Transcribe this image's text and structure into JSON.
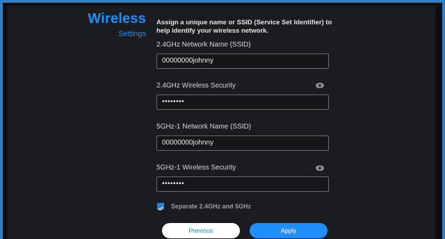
{
  "section": {
    "title": "Wireless",
    "subtitle": "Settings"
  },
  "intro_text": "Assign a unique name or SSID (Service Set Identifier) to help identify your wireless network.",
  "fields": {
    "ssid_24": {
      "label": "2.4GHz Network Name (SSID)",
      "value": "00000000johnny"
    },
    "security_24": {
      "label": "2.4GHz Wireless Security",
      "value": "••••••••"
    },
    "ssid_5": {
      "label": "5GHz-1 Network Name (SSID)",
      "value": "00000000johnny"
    },
    "security_5": {
      "label": "5GHz-1 Wireless Security",
      "value": "••••••••"
    }
  },
  "separate_bands": {
    "label": "Separate 2.4GHz and 5GHz",
    "checked": true
  },
  "buttons": {
    "previous": "Previous",
    "apply": "Apply"
  },
  "icons": {
    "show_password": "eye-icon",
    "checkbox": "checkmark-icon"
  },
  "colors": {
    "accent": "#1f8fff",
    "background": "#1a1c1f",
    "border": "#2f7fd1"
  }
}
